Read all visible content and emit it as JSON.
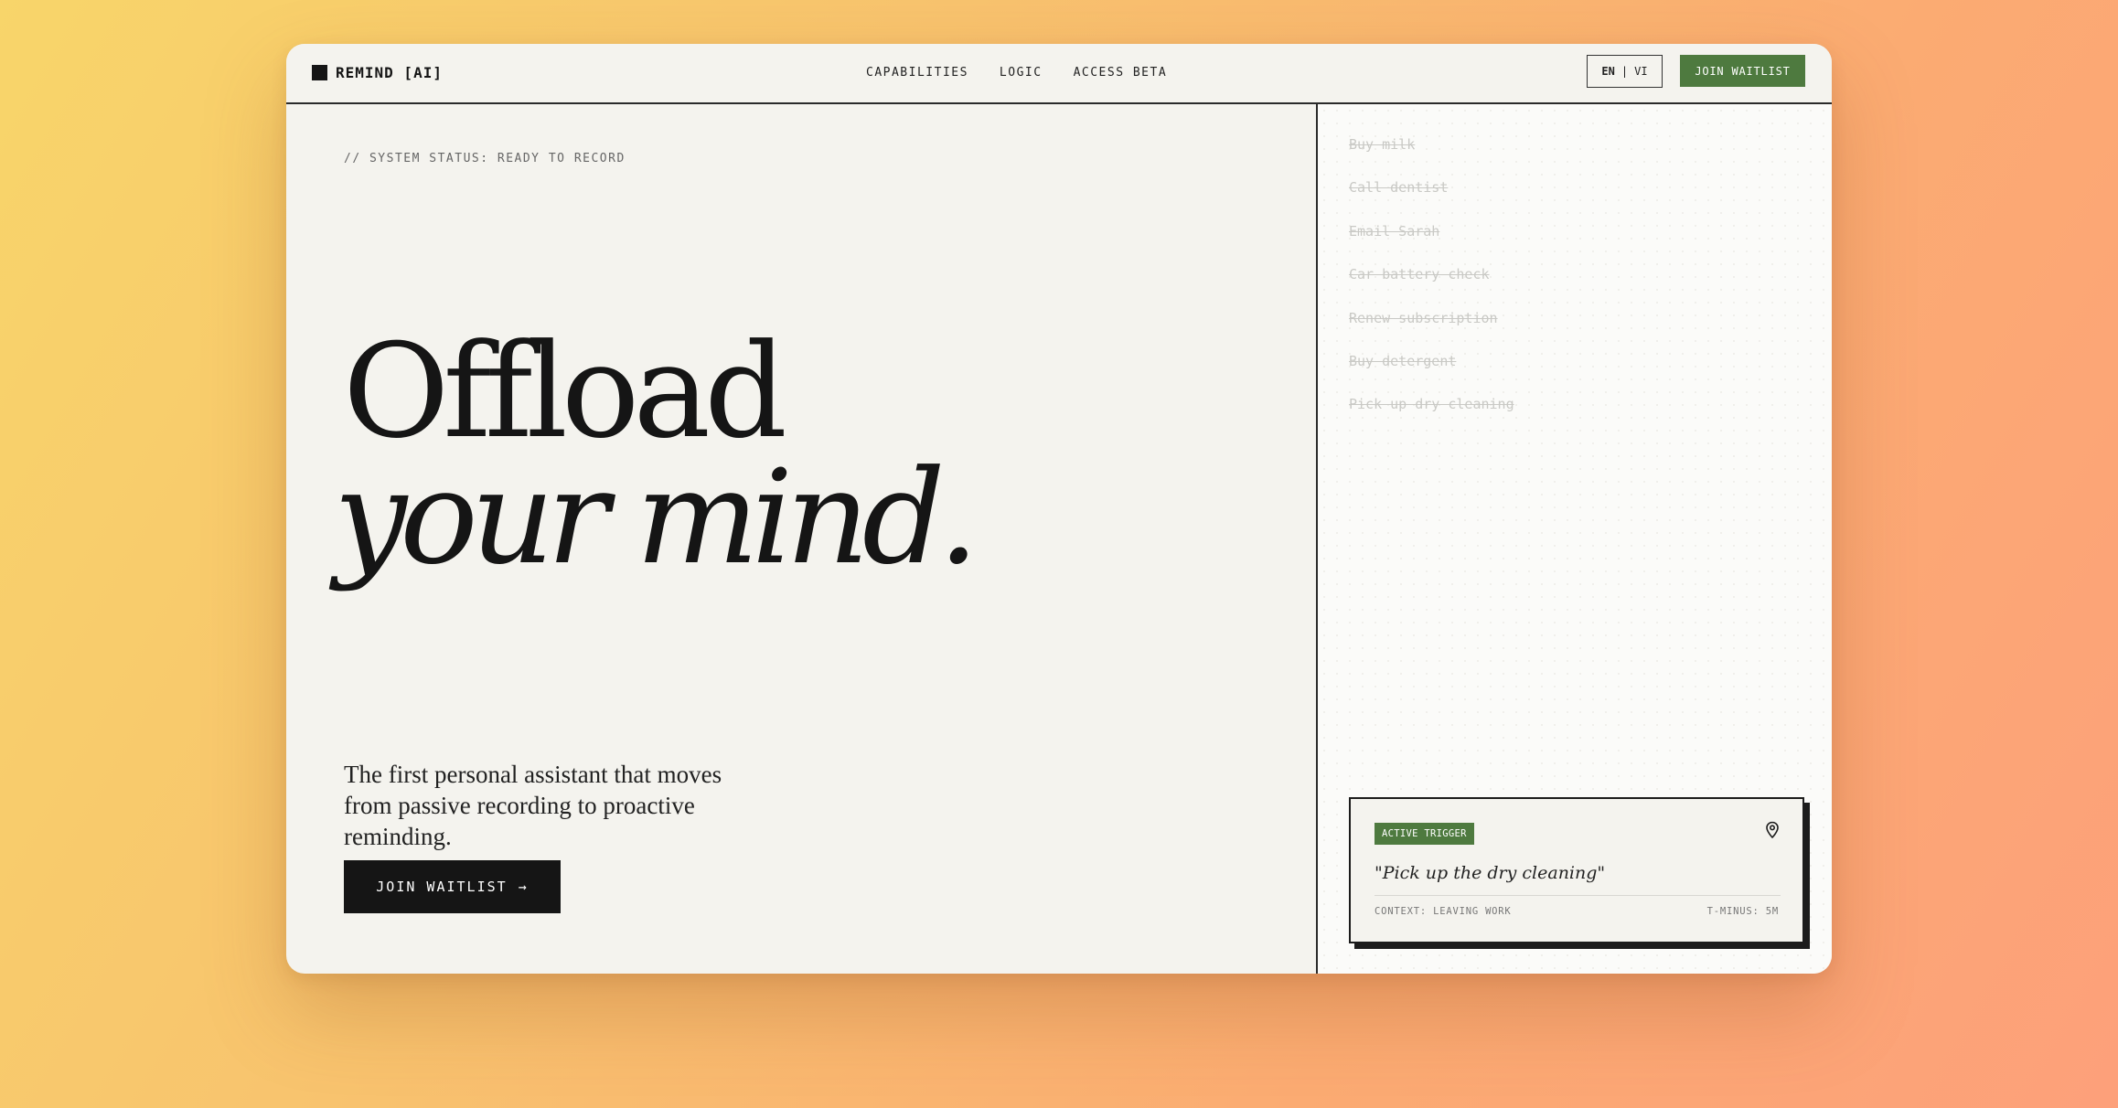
{
  "nav": {
    "logo_text": "REMIND [AI]",
    "links": [
      "CAPABILITIES",
      "LOGIC",
      "ACCESS BETA"
    ],
    "lang": {
      "primary": "EN",
      "separator": "|",
      "secondary": "VI"
    },
    "cta_label": "JOIN WAITLIST"
  },
  "hero": {
    "status": "// SYSTEM STATUS: READY TO RECORD",
    "headline_line1": "Offload",
    "headline_line2": "your mind.",
    "subtitle": "The first personal assistant that moves from passive recording to proactive reminding.",
    "cta_label": "JOIN WAITLIST",
    "cta_arrow": "→"
  },
  "tasks": [
    "Buy milk",
    "Call dentist",
    "Email Sarah",
    "Car battery check",
    "Renew subscription",
    "Buy detergent",
    "Pick up dry cleaning"
  ],
  "trigger": {
    "badge": "ACTIVE TRIGGER",
    "icon": "map-pin-icon",
    "quote": "\"Pick up the dry cleaning\"",
    "context": "CONTEXT: LEAVING WORK",
    "timer": "T-MINUS: 5M"
  },
  "colors": {
    "accent_green": "#4e7a3f",
    "ink": "#151515",
    "paper": "#f4f3ee"
  }
}
